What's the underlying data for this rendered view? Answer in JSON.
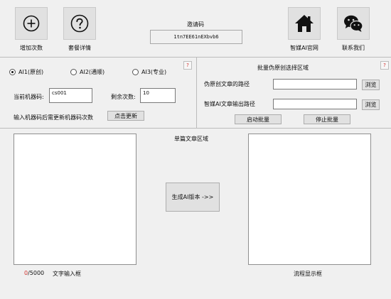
{
  "toolbar": {
    "add_count_label": "增加次数",
    "package_details_label": "套餐详情",
    "official_site_label": "智媒AI官网",
    "contact_label": "联系我们"
  },
  "invite": {
    "title": "邀请码",
    "code": "1tn7EE61nEXbvb6"
  },
  "mode_section": {
    "help": "?",
    "radios": [
      {
        "label": "AI1(原创)",
        "selected": true
      },
      {
        "label": "AI2(通顺)",
        "selected": false
      },
      {
        "label": "AI3(专业)",
        "selected": false
      }
    ],
    "machine_code_label": "当前机器码:",
    "machine_code_value": "cs001",
    "remaining_label": "剩余次数:",
    "remaining_value": "10",
    "hint": "输入机器码后需更新机器码次数",
    "update_button": "点击更新"
  },
  "batch_section": {
    "title": "批量伪原创选择区域",
    "help": "?",
    "source_path_label": "伪原创文章的路径",
    "source_path_value": "",
    "output_path_label": "智媒AI文章输出路径",
    "output_path_value": "",
    "browse_label": "浏览",
    "start_button": "启动批量",
    "stop_button": "停止批量"
  },
  "single_section": {
    "title": "单篇文章区域",
    "generate_button": "生成AI版本 ->>",
    "input_text": "",
    "output_text": "",
    "char_count": "0",
    "char_limit": "/5000",
    "input_caption": "文字输入框",
    "output_caption": "流程显示框"
  }
}
